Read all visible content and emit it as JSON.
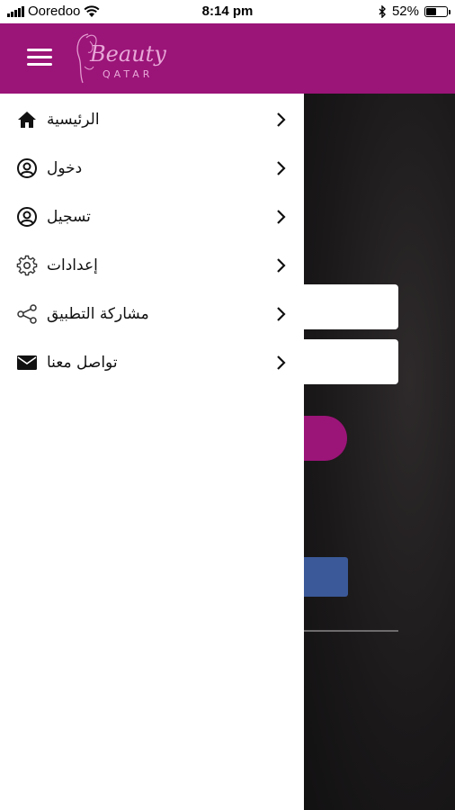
{
  "status_bar": {
    "carrier": "Ooredoo",
    "time": "8:14 pm",
    "battery_percent": "52%",
    "battery_level": 0.52
  },
  "header": {
    "logo_script": "Beauty",
    "logo_sub": "QATAR",
    "background_color": "#9b1478"
  },
  "drawer": {
    "items": [
      {
        "label": "الرئيسية",
        "icon": "home-icon"
      },
      {
        "label": "دخول",
        "icon": "user-circle-icon"
      },
      {
        "label": "تسجيل",
        "icon": "user-circle-icon"
      },
      {
        "label": "إعدادات",
        "icon": "gear-icon"
      },
      {
        "label": "مشاركة التطبيق",
        "icon": "share-icon"
      },
      {
        "label": "تواصل معنا",
        "icon": "envelope-icon"
      }
    ]
  },
  "colors": {
    "brand": "#9b1478",
    "facebook": "#3b5998"
  }
}
